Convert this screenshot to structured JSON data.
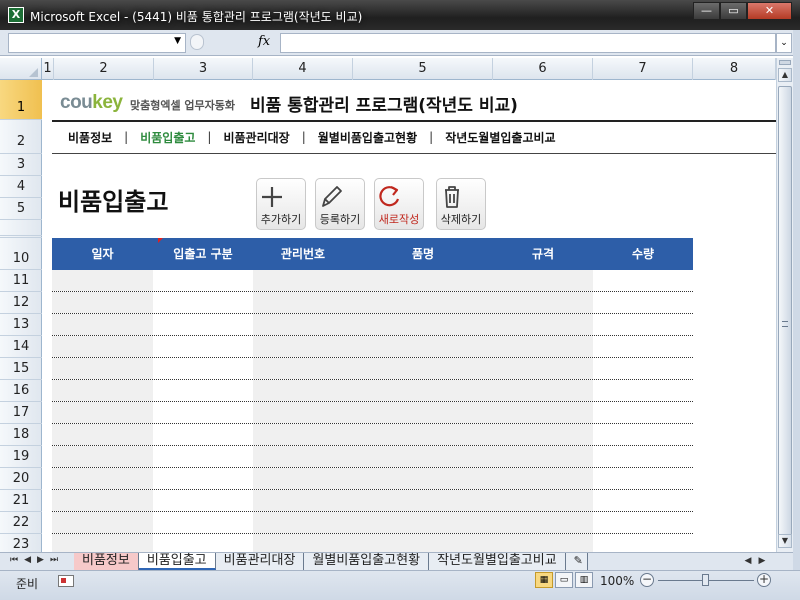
{
  "window": {
    "title": "Microsoft Excel - (5441) 비품 통합관리 프로그램(작년도 비교)",
    "app_icon": "X",
    "minimize": "—",
    "maximize": "▭",
    "close": "✕"
  },
  "formula_bar": {
    "fx_label": "fx",
    "namebox_value": "",
    "formula_value": ""
  },
  "columns": [
    "1",
    "2",
    "3",
    "4",
    "5",
    "6",
    "7",
    "8"
  ],
  "rows": [
    "1",
    "2",
    "3",
    "4",
    "5",
    "10",
    "11",
    "12",
    "13",
    "14",
    "15",
    "16",
    "17",
    "18",
    "19",
    "20",
    "21",
    "22",
    "23"
  ],
  "header": {
    "logo_co": "cou",
    "logo_key": "key",
    "logo_sub": "맞춤형엑셀 업무자동화",
    "title": "비품 통합관리 프로그램(작년도 비교)"
  },
  "nav": {
    "items": [
      {
        "label": "비품정보",
        "active": false
      },
      {
        "label": "비품입출고",
        "active": true
      },
      {
        "label": "비품관리대장",
        "active": false
      },
      {
        "label": "월별비품입출고현황",
        "active": false
      },
      {
        "label": "작년도월별입출고비교",
        "active": false
      }
    ],
    "separator": "|"
  },
  "page_title": "비품입출고",
  "toolbar": {
    "add_label": "추가하기",
    "register_label": "등록하기",
    "new_label": "새로작성",
    "delete_label": "삭제하기"
  },
  "table": {
    "headers": [
      "일자",
      "입출고 구분",
      "관리번호",
      "품명",
      "규격",
      "수량"
    ],
    "row_count": 13
  },
  "sheet_tabs": {
    "tabs": [
      {
        "label": "비품정보",
        "state": "red"
      },
      {
        "label": "비품입출고",
        "state": "active"
      },
      {
        "label": "비품관리대장",
        "state": "normal"
      },
      {
        "label": "월별비품입출고현황",
        "state": "normal"
      },
      {
        "label": "작년도월별입출고비교",
        "state": "normal"
      }
    ]
  },
  "status": {
    "ready": "준비",
    "zoom": "100%"
  },
  "colors": {
    "table_header": "#2d5ea8",
    "active_nav": "#2e8b3e",
    "logo_key": "#8bb43c",
    "new_button": "#c0281e",
    "selected_row_header": "#f0c050"
  }
}
